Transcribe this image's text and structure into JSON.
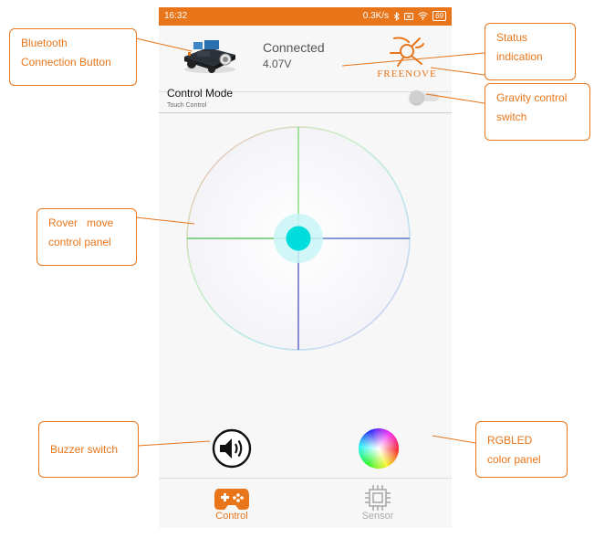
{
  "status_bar": {
    "time": "16:32",
    "speed": "0.3K/s",
    "battery": "69"
  },
  "header": {
    "connection_status": "Connected",
    "voltage": "4.07V",
    "logo_text": "FREENOVE"
  },
  "control_mode": {
    "title": "Control Mode",
    "subtitle": "Touch Control",
    "gravity_enabled": false
  },
  "bottom_nav": {
    "tabs": [
      {
        "label": "Control",
        "active": true
      },
      {
        "label": "Sensor",
        "active": false
      }
    ]
  },
  "callouts": {
    "bluetooth": [
      "Bluetooth",
      "Connection Button"
    ],
    "status": [
      "Status",
      "indication"
    ],
    "gravity": [
      "Gravity control",
      "switch"
    ],
    "rover": [
      "Rover   move",
      "control panel"
    ],
    "buzzer": [
      "Buzzer switch"
    ],
    "rgbled": [
      "RGBLED",
      "color panel"
    ]
  },
  "colors": {
    "accent": "#e8751a",
    "status_bar": "#e8751a",
    "joystick_knob": "#00dddd"
  },
  "icons": {
    "car": "rover-car-icon",
    "logo": "freenove-logo-icon",
    "buzzer": "speaker-icon",
    "rgb": "color-wheel-icon",
    "control_tab": "gamepad-icon",
    "sensor_tab": "chip-icon"
  }
}
